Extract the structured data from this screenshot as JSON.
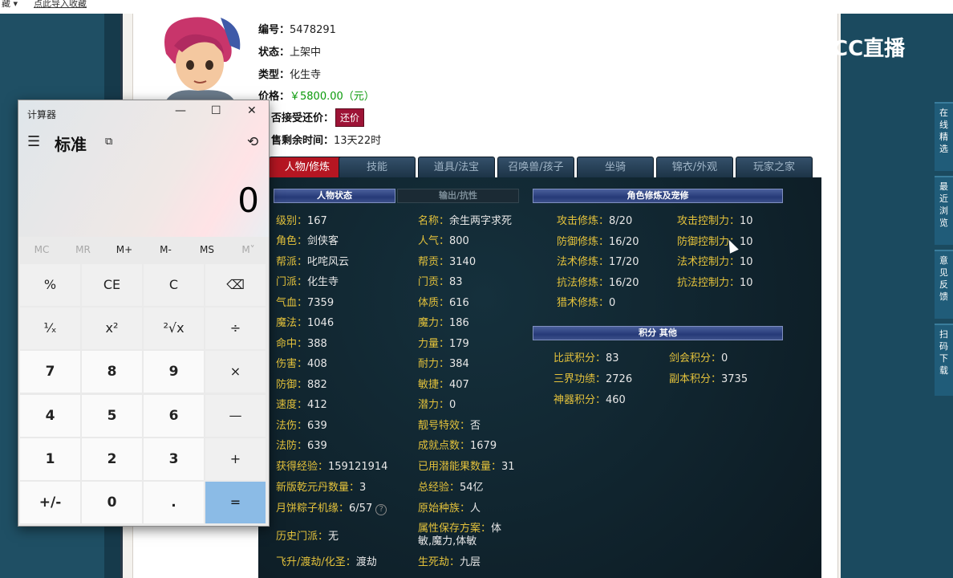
{
  "topbar": {
    "left_text": "藏 ▾",
    "bookmark_text": "点此导入收藏"
  },
  "listing": {
    "id_label": "编号：",
    "id_value": "5478291",
    "status_label": "状态：",
    "status_value": "上架中",
    "type_label": "类型：",
    "type_value": "化生寺",
    "price_label": "价格：",
    "price_value": "￥5800.00（元）",
    "counter_label": "否接受还价：",
    "counter_button": "还价",
    "remain_label": "售剩余时间：",
    "remain_value": "13天22时"
  },
  "tabs": [
    "人物/修炼",
    "技能",
    "道具/法宝",
    "召唤兽/孩子",
    "坐骑",
    "锦衣/外观",
    "玩家之家"
  ],
  "headers": {
    "char_status": "人物状态",
    "output_resist": "输出/抗性",
    "cultivation": "角色修炼及宠修",
    "points": "积分 其他"
  },
  "col1": [
    {
      "k": "级别：",
      "v": "167"
    },
    {
      "k": "角色：",
      "v": "剑侠客"
    },
    {
      "k": "帮派：",
      "v": "叱咤风云"
    },
    {
      "k": "门派：",
      "v": "化生寺"
    },
    {
      "k": "气血：",
      "v": "7359"
    },
    {
      "k": "魔法：",
      "v": "1046"
    },
    {
      "k": "命中：",
      "v": "388"
    },
    {
      "k": "伤害：",
      "v": "408"
    },
    {
      "k": "防御：",
      "v": "882"
    },
    {
      "k": "速度：",
      "v": "412"
    },
    {
      "k": "法伤：",
      "v": "639"
    },
    {
      "k": "法防：",
      "v": "639"
    },
    {
      "k": "获得经验：",
      "v": "159121914"
    },
    {
      "k": "新版乾元丹数量：",
      "v": "3"
    },
    {
      "k": "月饼粽子机缘：",
      "v": "6/57"
    },
    {
      "k": "历史门派：",
      "v": "无"
    },
    {
      "k": "飞升/渡劫/化圣：",
      "v": "渡劫"
    }
  ],
  "col2": [
    {
      "k": "名称：",
      "v": "余生两字求死"
    },
    {
      "k": "人气：",
      "v": "800"
    },
    {
      "k": "帮贡：",
      "v": "3140"
    },
    {
      "k": "门贡：",
      "v": "83"
    },
    {
      "k": "体质：",
      "v": "616"
    },
    {
      "k": "魔力：",
      "v": "186"
    },
    {
      "k": "力量：",
      "v": "179"
    },
    {
      "k": "耐力：",
      "v": "384"
    },
    {
      "k": "敏捷：",
      "v": "407"
    },
    {
      "k": "潜力：",
      "v": "0"
    },
    {
      "k": "靓号特效：",
      "v": "否"
    },
    {
      "k": "成就点数：",
      "v": "1679"
    },
    {
      "k": "已用潜能果数量：",
      "v": "31"
    },
    {
      "k": "总经验：",
      "v": "54亿"
    },
    {
      "k": "原始种族：",
      "v": "人"
    },
    {
      "k": "属性保存方案：",
      "v": "体"
    },
    {
      "k": "",
      "v": "敏,魔力,体敏"
    },
    {
      "k": "生死劫：",
      "v": "九层"
    }
  ],
  "cultivation": [
    {
      "k": "攻击修炼：",
      "v": "8/20",
      "k2": "攻击控制力：",
      "v2": "10"
    },
    {
      "k": "防御修炼：",
      "v": "16/20",
      "k2": "防御控制力：",
      "v2": "10"
    },
    {
      "k": "法术修炼：",
      "v": "17/20",
      "k2": "法术控制力：",
      "v2": "10"
    },
    {
      "k": "抗法修炼：",
      "v": "16/20",
      "k2": "抗法控制力：",
      "v2": "10"
    },
    {
      "k": "猎术修炼：",
      "v": "0",
      "k2": "",
      "v2": ""
    }
  ],
  "points": [
    {
      "k": "比武积分：",
      "v": "83",
      "k2": "剑会积分：",
      "v2": "0"
    },
    {
      "k": "三界功绩：",
      "v": "2726",
      "k2": "副本积分：",
      "v2": "3735"
    },
    {
      "k": "神器积分：",
      "v": "460",
      "k2": "",
      "v2": ""
    }
  ],
  "help_glyph": "?",
  "overlay": {
    "logo_text": "CC直播"
  },
  "sidebar": [
    "在线精选",
    "最近浏览",
    "意见反馈",
    "扫码下载"
  ],
  "calculator": {
    "title": "计算器",
    "minimize": "—",
    "maximize": "☐",
    "close": "✕",
    "menu": "☰",
    "mode": "标准",
    "keep_on_top": "⧉",
    "history": "⟲",
    "display": "0",
    "memory": [
      "MC",
      "MR",
      "M+",
      "M-",
      "MS",
      "M˅"
    ],
    "keys": [
      "%",
      "CE",
      "C",
      "⌫",
      "¹⁄ₓ",
      "x²",
      "²√x",
      "÷",
      "7",
      "8",
      "9",
      "×",
      "4",
      "5",
      "6",
      "—",
      "1",
      "2",
      "3",
      "+",
      "+/-",
      "0",
      ".",
      "="
    ]
  }
}
